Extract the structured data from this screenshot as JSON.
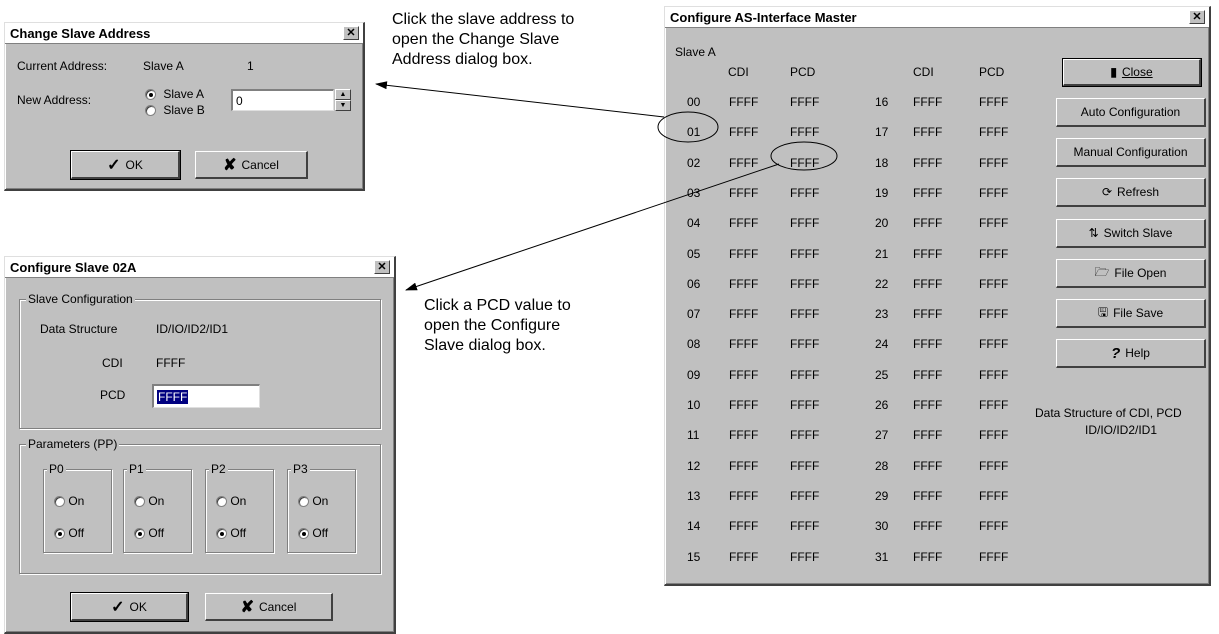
{
  "change_dialog": {
    "title": "Change Slave Address",
    "current_label": "Current Address:",
    "current_slave": "Slave A",
    "current_number": "1",
    "new_label": "New Address:",
    "option_a": "Slave A",
    "option_b": "Slave B",
    "selected": "Slave A",
    "new_value": "0",
    "ok": "OK",
    "cancel": "Cancel"
  },
  "configure_slave": {
    "title": "Configure Slave 02A",
    "group_label": "Slave Configuration",
    "ds_label": "Data Structure",
    "ds_value": "ID/IO/ID2/ID1",
    "cdi_label": "CDI",
    "cdi_value": "FFFF",
    "pcd_label": "PCD",
    "pcd_value": "FFFF",
    "params_label": "Parameters (PP)",
    "params": [
      {
        "name": "P0",
        "on": "On",
        "off": "Off",
        "selected": "Off"
      },
      {
        "name": "P1",
        "on": "On",
        "off": "Off",
        "selected": "Off"
      },
      {
        "name": "P2",
        "on": "On",
        "off": "Off",
        "selected": "Off"
      },
      {
        "name": "P3",
        "on": "On",
        "off": "Off",
        "selected": "Off"
      }
    ],
    "ok": "OK",
    "cancel": "Cancel"
  },
  "master": {
    "title": "Configure AS-Interface Master",
    "slave_label": "Slave A",
    "col_cdi": "CDI",
    "col_pcd": "PCD",
    "rows": [
      [
        "00",
        "FFFF",
        "FFFF"
      ],
      [
        "01",
        "FFFF",
        "FFFF"
      ],
      [
        "02",
        "FFFF",
        "FFFF"
      ],
      [
        "03",
        "FFFF",
        "FFFF"
      ],
      [
        "04",
        "FFFF",
        "FFFF"
      ],
      [
        "05",
        "FFFF",
        "FFFF"
      ],
      [
        "06",
        "FFFF",
        "FFFF"
      ],
      [
        "07",
        "FFFF",
        "FFFF"
      ],
      [
        "08",
        "FFFF",
        "FFFF"
      ],
      [
        "09",
        "FFFF",
        "FFFF"
      ],
      [
        "10",
        "FFFF",
        "FFFF"
      ],
      [
        "11",
        "FFFF",
        "FFFF"
      ],
      [
        "12",
        "FFFF",
        "FFFF"
      ],
      [
        "13",
        "FFFF",
        "FFFF"
      ],
      [
        "14",
        "FFFF",
        "FFFF"
      ],
      [
        "15",
        "FFFF",
        "FFFF"
      ],
      [
        "16",
        "FFFF",
        "FFFF"
      ],
      [
        "17",
        "FFFF",
        "FFFF"
      ],
      [
        "18",
        "FFFF",
        "FFFF"
      ],
      [
        "19",
        "FFFF",
        "FFFF"
      ],
      [
        "20",
        "FFFF",
        "FFFF"
      ],
      [
        "21",
        "FFFF",
        "FFFF"
      ],
      [
        "22",
        "FFFF",
        "FFFF"
      ],
      [
        "23",
        "FFFF",
        "FFFF"
      ],
      [
        "24",
        "FFFF",
        "FFFF"
      ],
      [
        "25",
        "FFFF",
        "FFFF"
      ],
      [
        "26",
        "FFFF",
        "FFFF"
      ],
      [
        "27",
        "FFFF",
        "FFFF"
      ],
      [
        "28",
        "FFFF",
        "FFFF"
      ],
      [
        "29",
        "FFFF",
        "FFFF"
      ],
      [
        "30",
        "FFFF",
        "FFFF"
      ],
      [
        "31",
        "FFFF",
        "FFFF"
      ]
    ],
    "buttons": {
      "close": "Close",
      "auto": "Auto Configuration",
      "manual": "Manual Configuration",
      "refresh": "Refresh",
      "switch": "Switch Slave",
      "open": "File Open",
      "save": "File Save",
      "help": "Help"
    },
    "info_line1": "Data Structure of CDI, PCD",
    "info_line2": "ID/IO/ID2/ID1"
  },
  "annotations": {
    "note1": [
      "Click the slave address to",
      "open the Change Slave",
      "Address dialog box."
    ],
    "note2": [
      "Click a PCD value to",
      "open the Configure",
      "Slave dialog box."
    ]
  },
  "icons": {
    "ok": "checkmark-icon",
    "cancel": "x-icon",
    "close": "door-icon",
    "refresh": "refresh-icon",
    "switch": "switch-icon",
    "open": "folder-open-icon",
    "save": "floppy-disk-icon",
    "help": "question-icon"
  }
}
